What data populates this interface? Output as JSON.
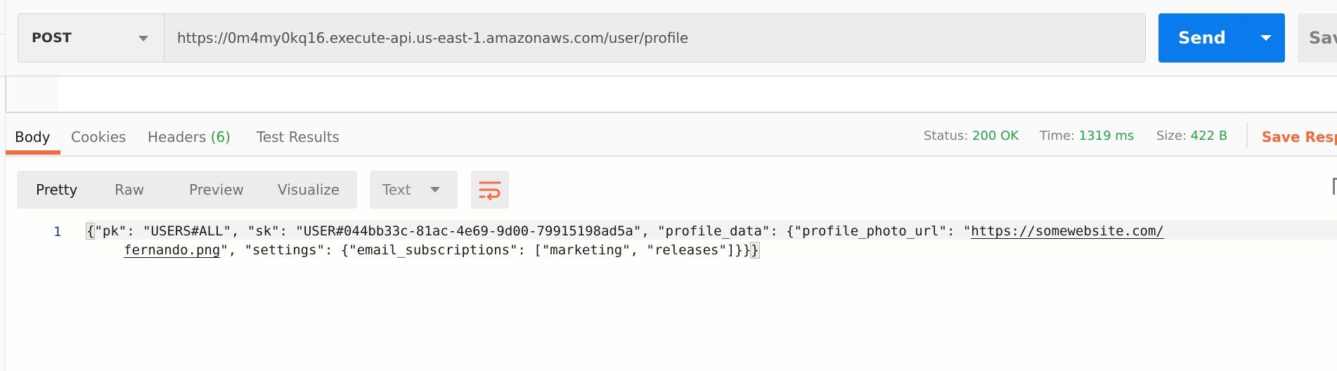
{
  "request": {
    "method": "POST",
    "url": "https://0m4my0kq16.execute-api.us-east-1.amazonaws.com/user/profile",
    "send_label": "Send",
    "save_label": "Save"
  },
  "response_tabs": [
    {
      "label": "Body",
      "active": true
    },
    {
      "label": "Cookies"
    },
    {
      "label": "Headers",
      "count": "(6)"
    },
    {
      "label": "Test Results"
    }
  ],
  "status": {
    "status_label": "Status:",
    "status_value": "200 OK",
    "time_label": "Time:",
    "time_value": "1319 ms",
    "size_label": "Size:",
    "size_value": "422 B",
    "save_response_label": "Save Response"
  },
  "colors": {
    "accent": "#f26b3a",
    "send": "#097bed",
    "success": "#26a543"
  },
  "view_modes": [
    "Pretty",
    "Raw",
    "Preview",
    "Visualize"
  ],
  "active_view_mode": "Pretty",
  "format": "Text",
  "wrap_icon": "wrap-lines-icon",
  "code": {
    "line_number": "1",
    "open_brace": "{",
    "line1_text": "\"pk\": \"USERS#ALL\", \"sk\": \"USER#044bb33c-81ac-4e69-9d00-79915198ad5a\", \"profile_data\": {\"profile_photo_url\": \"",
    "link_part1": "https://somewebsite.com/",
    "link_part2": "fernando.png",
    "line2_text": "\", \"settings\": {\"email_subscriptions\": [\"marketing\", \"releases\"]}}",
    "close_brace": "}"
  }
}
